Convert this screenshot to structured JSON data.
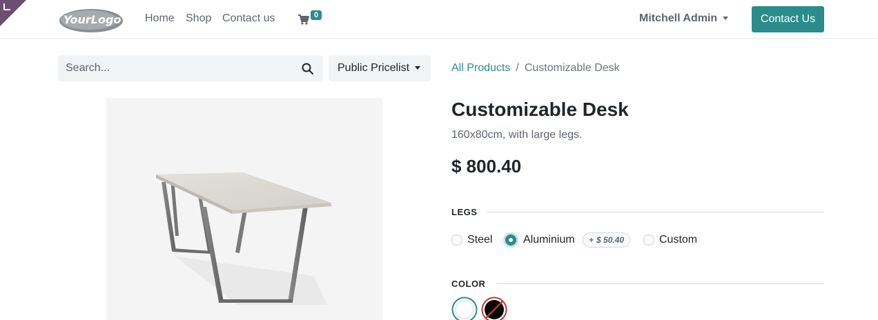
{
  "header": {
    "logo_text": "YourLogo",
    "nav": [
      {
        "label": "Home"
      },
      {
        "label": "Shop"
      },
      {
        "label": "Contact us"
      }
    ],
    "cart_count": "0",
    "user_name": "Mitchell Admin",
    "contact_button": "Contact Us"
  },
  "search": {
    "placeholder": "Search...",
    "pricelist": "Public Pricelist"
  },
  "breadcrumb": {
    "parent": "All Products",
    "separator": "/",
    "current": "Customizable Desk"
  },
  "product": {
    "name": "Customizable Desk",
    "description": "160x80cm, with large legs.",
    "price": "$ 800.40"
  },
  "attributes": {
    "legs": {
      "heading": "LEGS",
      "options": [
        {
          "label": "Steel",
          "selected": false
        },
        {
          "label": "Aluminium",
          "selected": true,
          "extra_sign": "+",
          "extra_price": "$ 50.40"
        },
        {
          "label": "Custom",
          "selected": false
        }
      ]
    },
    "color": {
      "heading": "COLOR",
      "swatches": [
        {
          "name": "white",
          "color": "#ffffff",
          "selected": true
        },
        {
          "name": "black",
          "color": "#000000",
          "selected": false,
          "unavailable": true
        }
      ]
    }
  },
  "colors": {
    "accent": "#2a8c8c",
    "corner": "#6b4e71",
    "unavailable": "#c0392b"
  }
}
